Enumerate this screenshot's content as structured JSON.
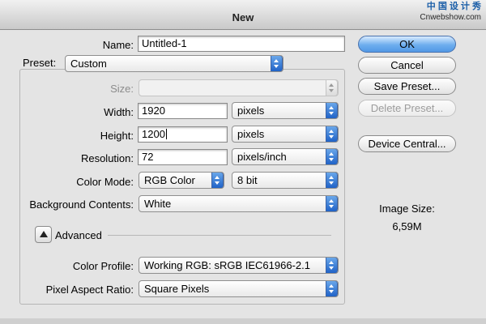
{
  "window": {
    "title": "New"
  },
  "watermark": {
    "line1": "中 国 设 计 秀",
    "line2": "Cnwebshow.com"
  },
  "form": {
    "name": {
      "label": "Name:",
      "value": "Untitled-1"
    },
    "preset": {
      "label": "Preset:",
      "value": "Custom"
    },
    "size": {
      "label": "Size:",
      "value": ""
    },
    "width": {
      "label": "Width:",
      "value": "1920",
      "unit": "pixels"
    },
    "height": {
      "label": "Height:",
      "value": "1200",
      "unit": "pixels"
    },
    "resolution": {
      "label": "Resolution:",
      "value": "72",
      "unit": "pixels/inch"
    },
    "color_mode": {
      "label": "Color Mode:",
      "value": "RGB Color",
      "depth": "8 bit"
    },
    "background": {
      "label": "Background Contents:",
      "value": "White"
    },
    "advanced": {
      "label": "Advanced"
    },
    "color_profile": {
      "label": "Color Profile:",
      "value": "Working RGB:  sRGB IEC61966-2.1"
    },
    "pixel_aspect": {
      "label": "Pixel Aspect Ratio:",
      "value": "Square Pixels"
    }
  },
  "buttons": {
    "ok": "OK",
    "cancel": "Cancel",
    "save_preset": "Save Preset...",
    "delete_preset": "Delete Preset...",
    "device_central": "Device Central..."
  },
  "image_size": {
    "label": "Image Size:",
    "value": "6,59M"
  },
  "colors": {
    "accent": "#5198e6",
    "popup_arrow": "#1f62c7"
  }
}
